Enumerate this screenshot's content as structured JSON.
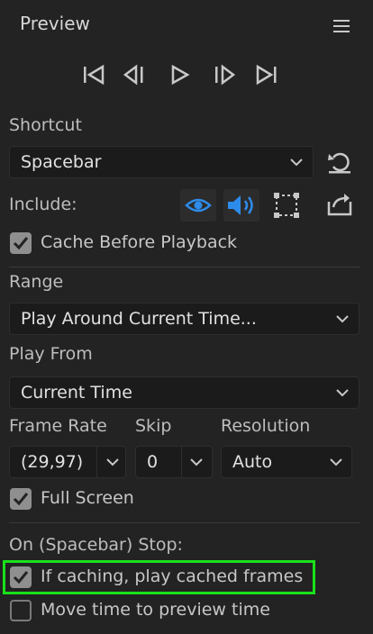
{
  "panel": {
    "title": "Preview"
  },
  "icons": {
    "menu": "hamburger-menu-icon",
    "transport": [
      "first-frame-icon",
      "previous-frame-icon",
      "play-icon",
      "next-frame-icon",
      "last-frame-icon"
    ],
    "include": [
      "video-eye-icon",
      "audio-speaker-icon",
      "overlays-icon"
    ]
  },
  "shortcut": {
    "label": "Shortcut",
    "value": "Spacebar"
  },
  "include": {
    "label": "Include:"
  },
  "cache_before_playback": {
    "label": "Cache Before Playback",
    "checked": true
  },
  "range": {
    "label": "Range",
    "value": "Play Around Current Time..."
  },
  "play_from": {
    "label": "Play From",
    "value": "Current Time"
  },
  "frame_rate": {
    "label": "Frame Rate",
    "value": "(29,97)"
  },
  "skip": {
    "label": "Skip",
    "value": "0"
  },
  "resolution": {
    "label": "Resolution",
    "value": "Auto"
  },
  "full_screen": {
    "label": "Full Screen",
    "checked": true
  },
  "stop_section": {
    "label": "On (Spacebar) Stop:"
  },
  "if_caching": {
    "label": "If caching, play cached frames",
    "checked": true
  },
  "move_time": {
    "label": "Move time to preview time",
    "checked": false
  },
  "colors": {
    "accent": "#2d8ceb",
    "highlight": "#19e11b",
    "background": "#232323"
  }
}
